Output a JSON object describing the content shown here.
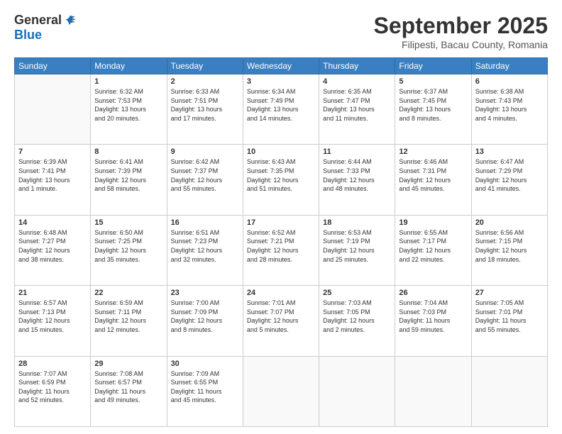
{
  "header": {
    "logo_general": "General",
    "logo_blue": "Blue",
    "month_title": "September 2025",
    "subtitle": "Filipesti, Bacau County, Romania"
  },
  "weekdays": [
    "Sunday",
    "Monday",
    "Tuesday",
    "Wednesday",
    "Thursday",
    "Friday",
    "Saturday"
  ],
  "weeks": [
    [
      {
        "day": "",
        "info": ""
      },
      {
        "day": "1",
        "info": "Sunrise: 6:32 AM\nSunset: 7:53 PM\nDaylight: 13 hours\nand 20 minutes."
      },
      {
        "day": "2",
        "info": "Sunrise: 6:33 AM\nSunset: 7:51 PM\nDaylight: 13 hours\nand 17 minutes."
      },
      {
        "day": "3",
        "info": "Sunrise: 6:34 AM\nSunset: 7:49 PM\nDaylight: 13 hours\nand 14 minutes."
      },
      {
        "day": "4",
        "info": "Sunrise: 6:35 AM\nSunset: 7:47 PM\nDaylight: 13 hours\nand 11 minutes."
      },
      {
        "day": "5",
        "info": "Sunrise: 6:37 AM\nSunset: 7:45 PM\nDaylight: 13 hours\nand 8 minutes."
      },
      {
        "day": "6",
        "info": "Sunrise: 6:38 AM\nSunset: 7:43 PM\nDaylight: 13 hours\nand 4 minutes."
      }
    ],
    [
      {
        "day": "7",
        "info": "Sunrise: 6:39 AM\nSunset: 7:41 PM\nDaylight: 13 hours\nand 1 minute."
      },
      {
        "day": "8",
        "info": "Sunrise: 6:41 AM\nSunset: 7:39 PM\nDaylight: 12 hours\nand 58 minutes."
      },
      {
        "day": "9",
        "info": "Sunrise: 6:42 AM\nSunset: 7:37 PM\nDaylight: 12 hours\nand 55 minutes."
      },
      {
        "day": "10",
        "info": "Sunrise: 6:43 AM\nSunset: 7:35 PM\nDaylight: 12 hours\nand 51 minutes."
      },
      {
        "day": "11",
        "info": "Sunrise: 6:44 AM\nSunset: 7:33 PM\nDaylight: 12 hours\nand 48 minutes."
      },
      {
        "day": "12",
        "info": "Sunrise: 6:46 AM\nSunset: 7:31 PM\nDaylight: 12 hours\nand 45 minutes."
      },
      {
        "day": "13",
        "info": "Sunrise: 6:47 AM\nSunset: 7:29 PM\nDaylight: 12 hours\nand 41 minutes."
      }
    ],
    [
      {
        "day": "14",
        "info": "Sunrise: 6:48 AM\nSunset: 7:27 PM\nDaylight: 12 hours\nand 38 minutes."
      },
      {
        "day": "15",
        "info": "Sunrise: 6:50 AM\nSunset: 7:25 PM\nDaylight: 12 hours\nand 35 minutes."
      },
      {
        "day": "16",
        "info": "Sunrise: 6:51 AM\nSunset: 7:23 PM\nDaylight: 12 hours\nand 32 minutes."
      },
      {
        "day": "17",
        "info": "Sunrise: 6:52 AM\nSunset: 7:21 PM\nDaylight: 12 hours\nand 28 minutes."
      },
      {
        "day": "18",
        "info": "Sunrise: 6:53 AM\nSunset: 7:19 PM\nDaylight: 12 hours\nand 25 minutes."
      },
      {
        "day": "19",
        "info": "Sunrise: 6:55 AM\nSunset: 7:17 PM\nDaylight: 12 hours\nand 22 minutes."
      },
      {
        "day": "20",
        "info": "Sunrise: 6:56 AM\nSunset: 7:15 PM\nDaylight: 12 hours\nand 18 minutes."
      }
    ],
    [
      {
        "day": "21",
        "info": "Sunrise: 6:57 AM\nSunset: 7:13 PM\nDaylight: 12 hours\nand 15 minutes."
      },
      {
        "day": "22",
        "info": "Sunrise: 6:59 AM\nSunset: 7:11 PM\nDaylight: 12 hours\nand 12 minutes."
      },
      {
        "day": "23",
        "info": "Sunrise: 7:00 AM\nSunset: 7:09 PM\nDaylight: 12 hours\nand 8 minutes."
      },
      {
        "day": "24",
        "info": "Sunrise: 7:01 AM\nSunset: 7:07 PM\nDaylight: 12 hours\nand 5 minutes."
      },
      {
        "day": "25",
        "info": "Sunrise: 7:03 AM\nSunset: 7:05 PM\nDaylight: 12 hours\nand 2 minutes."
      },
      {
        "day": "26",
        "info": "Sunrise: 7:04 AM\nSunset: 7:03 PM\nDaylight: 11 hours\nand 59 minutes."
      },
      {
        "day": "27",
        "info": "Sunrise: 7:05 AM\nSunset: 7:01 PM\nDaylight: 11 hours\nand 55 minutes."
      }
    ],
    [
      {
        "day": "28",
        "info": "Sunrise: 7:07 AM\nSunset: 6:59 PM\nDaylight: 11 hours\nand 52 minutes."
      },
      {
        "day": "29",
        "info": "Sunrise: 7:08 AM\nSunset: 6:57 PM\nDaylight: 11 hours\nand 49 minutes."
      },
      {
        "day": "30",
        "info": "Sunrise: 7:09 AM\nSunset: 6:55 PM\nDaylight: 11 hours\nand 45 minutes."
      },
      {
        "day": "",
        "info": ""
      },
      {
        "day": "",
        "info": ""
      },
      {
        "day": "",
        "info": ""
      },
      {
        "day": "",
        "info": ""
      }
    ]
  ]
}
